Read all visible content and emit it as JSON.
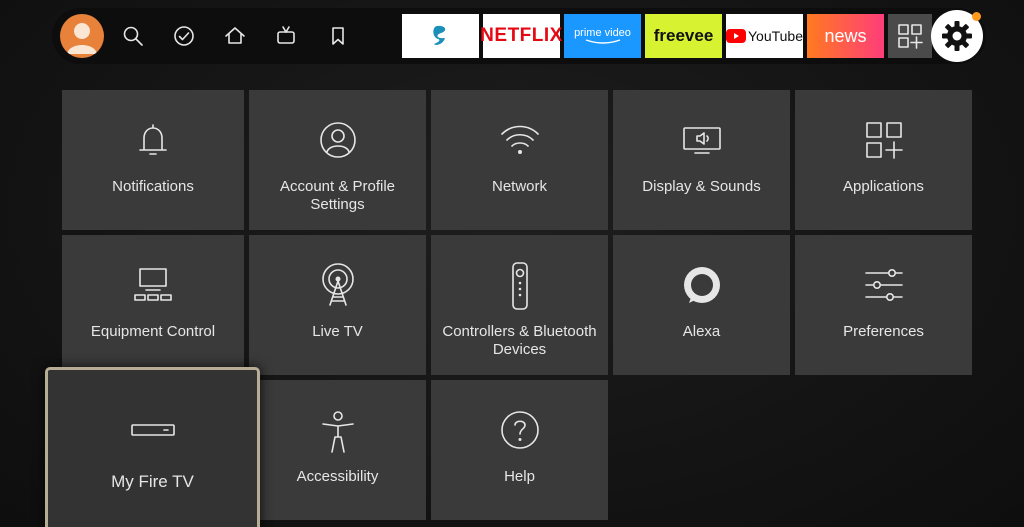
{
  "nav": {
    "icons": [
      "profile-avatar-icon",
      "search-icon",
      "check-circle-icon",
      "home-icon",
      "live-tv-icon",
      "bookmark-icon"
    ]
  },
  "apps": [
    {
      "label": "",
      "name": "surfshark-app",
      "bg": "#ffffff",
      "fg": "#1a8fb8"
    },
    {
      "label": "NETFLIX",
      "name": "netflix-app",
      "bg": "#ffffff",
      "fg": "#e50914"
    },
    {
      "label": "prime video",
      "name": "prime-video-app",
      "bg": "#1a98ff",
      "fg": "#ffffff"
    },
    {
      "label": "freevee",
      "name": "freevee-app",
      "bg": "#d7f231",
      "fg": "#111111"
    },
    {
      "label": "YouTube",
      "name": "youtube-app",
      "bg": "#ffffff",
      "fg": "#111111"
    },
    {
      "label": "news",
      "name": "news-app",
      "bg": "#ff6a2b",
      "fg": "#ffffff"
    }
  ],
  "settings_tiles": [
    {
      "label": "Notifications",
      "icon": "bell-icon"
    },
    {
      "label": "Account & Profile Settings",
      "icon": "account-icon"
    },
    {
      "label": "Network",
      "icon": "wifi-icon"
    },
    {
      "label": "Display & Sounds",
      "icon": "display-icon"
    },
    {
      "label": "Applications",
      "icon": "applications-icon"
    },
    {
      "label": "Equipment Control",
      "icon": "equipment-icon"
    },
    {
      "label": "Live TV",
      "icon": "antenna-icon"
    },
    {
      "label": "Controllers & Bluetooth Devices",
      "icon": "remote-icon"
    },
    {
      "label": "Alexa",
      "icon": "alexa-icon"
    },
    {
      "label": "Preferences",
      "icon": "sliders-icon"
    },
    {
      "label": "My Fire TV",
      "icon": "fire-tv-device-icon"
    },
    {
      "label": "Accessibility",
      "icon": "accessibility-icon"
    },
    {
      "label": "Help",
      "icon": "help-icon"
    }
  ],
  "focused_tile": "My Fire TV",
  "colors": {
    "tile_bg": "#3a3a3a",
    "focus_border": "#b7ad94",
    "notification_dot": "#ff9a1f",
    "avatar": "#e8823b"
  }
}
